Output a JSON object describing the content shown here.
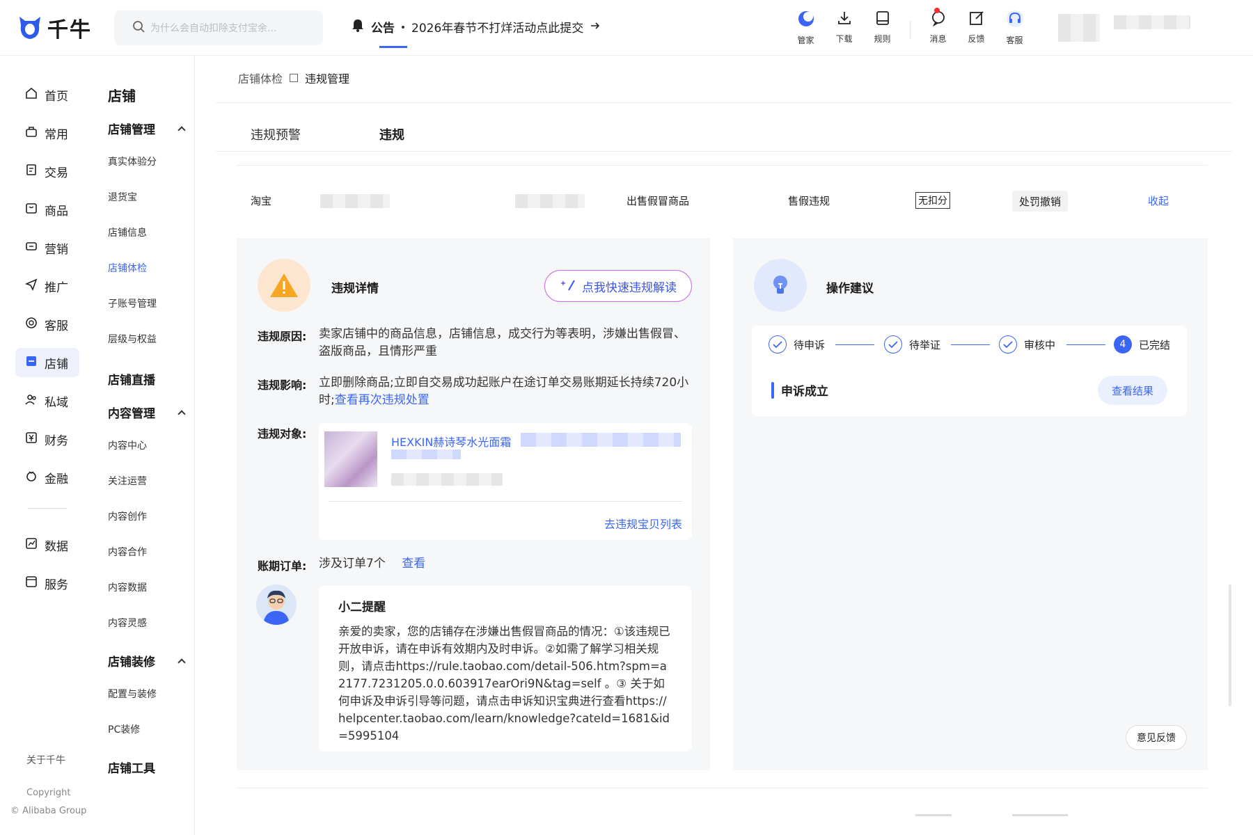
{
  "header": {
    "logo_text": "千牛",
    "search_placeholder": "为什么会自动扣除支付宝余...",
    "notice_label": "公告",
    "notice_text": "2026年春节不打烊活动点此提交",
    "tools": [
      {
        "label": "管家",
        "icon": "butler-icon"
      },
      {
        "label": "下载",
        "icon": "download-icon"
      },
      {
        "label": "规则",
        "icon": "rules-icon"
      },
      {
        "label": "消息",
        "icon": "message-icon"
      },
      {
        "label": "反馈",
        "icon": "feedback-icon"
      },
      {
        "label": "客服",
        "icon": "headset-icon"
      }
    ]
  },
  "nav_primary": {
    "items": [
      "首页",
      "常用",
      "交易",
      "商品",
      "营销",
      "推广",
      "客服",
      "店铺",
      "私域",
      "财务",
      "金融",
      "数据",
      "服务"
    ],
    "active": "店铺",
    "about": "关于千牛",
    "copyright": "Copyright",
    "company": "© Alibaba Group"
  },
  "nav_secondary": {
    "title": "店铺",
    "groups": [
      {
        "title": "店铺管理",
        "items": [
          "真实体验分",
          "退货宝",
          "店铺信息",
          "店铺体检",
          "子账号管理",
          "层级与权益"
        ]
      },
      {
        "title": "店铺直播",
        "items": []
      },
      {
        "title": "内容管理",
        "items": [
          "内容中心",
          "关注运营",
          "内容创作",
          "内容合作",
          "内容数据",
          "内容灵感"
        ]
      },
      {
        "title": "店铺装修",
        "items": [
          "配置与装修",
          "PC装修"
        ]
      },
      {
        "title": "店铺工具",
        "items": []
      }
    ],
    "active_item": "店铺体检"
  },
  "breadcrumb": {
    "parent": "店铺体检",
    "current": "违规管理"
  },
  "tabs": [
    {
      "label": "违规预警"
    },
    {
      "label": "违规"
    }
  ],
  "active_tab": "违规",
  "violation_row": {
    "platform": "淘宝",
    "type": "出售假冒商品",
    "category": "售假违规",
    "points": "无扣分",
    "status": "处罚撤销",
    "toggle": "收起"
  },
  "detail": {
    "title": "违规详情",
    "ai_button": "点我快速违规解读",
    "reason_label": "违规原因:",
    "reason": "卖家店铺中的商品信息，店铺信息，成交行为等表明，涉嫌出售假冒、盗版商品，且情形严重",
    "impact_label": "违规影响:",
    "impact": "立即删除商品;立即自交易成功起账户在途订单交易账期延长持续720小时;",
    "impact_link": "查看再次违规处置",
    "object_label": "违规对象:",
    "object_name": "HEXKIN赫诗琴水光面霜",
    "object_link": "去违规宝贝列表",
    "orders_label": "账期订单:",
    "orders_value": "涉及订单7个",
    "orders_link": "查看",
    "reminder_title": "小二提醒",
    "reminder_text": "亲爱的卖家，您的店铺存在涉嫌出售假冒商品的情况：①该违规已开放申诉，请在申诉有效期内及时申诉。②如需了解学习相关规则，请点击https://rule.taobao.com/detail-506.htm?spm=a2177.7231205.0.0.603917earOri9N&tag=self 。③ 关于如何申诉及申诉引导等问题，请点击申诉知识宝典进行查看https://helpcenter.taobao.com/learn/knowledge?cateId=1681&id=5995104"
  },
  "advice": {
    "title": "操作建议",
    "steps": [
      "待申诉",
      "待举证",
      "审核中",
      "已完结"
    ],
    "current_step": "4",
    "appeal_status": "申诉成立",
    "result_button": "查看结果"
  },
  "feedback_button": "意见反馈",
  "colors": {
    "accent": "#3b66f5",
    "warning": "#f5a623"
  }
}
